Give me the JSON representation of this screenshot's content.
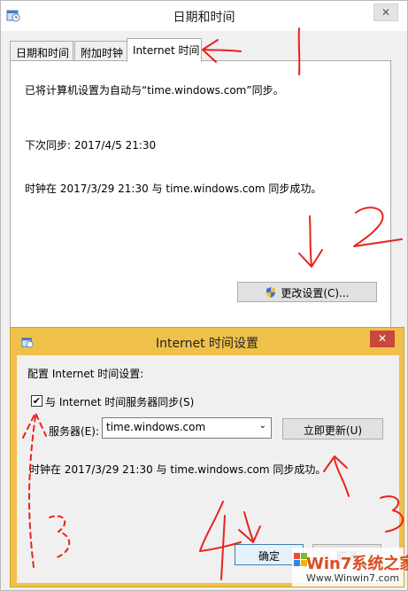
{
  "main_dialog": {
    "title": "日期和时间",
    "close_glyph": "✕",
    "tabs": [
      {
        "label": "日期和时间"
      },
      {
        "label": "附加时钟"
      },
      {
        "label": "Internet 时间"
      }
    ],
    "sync_info": "已将计算机设置为自动与“time.windows.com”同步。",
    "next_sync": "下次同步: 2017/4/5 21:30",
    "last_sync": "时钟在 2017/3/29 21:30 与 time.windows.com 同步成功。",
    "change_settings_label": "更改设置(C)..."
  },
  "sub_dialog": {
    "title": "Internet 时间设置",
    "close_glyph": "✕",
    "config_label": "配置 Internet 时间设置:",
    "sync_checkbox_label": "与 Internet 时间服务器同步(S)",
    "sync_checked": true,
    "server_label": "服务器(E):",
    "server_value": "time.windows.com",
    "update_now_label": "立即更新(U)",
    "status": "时钟在 2017/3/29 21:30 与 time.windows.com 同步成功。",
    "ok_label": "确定",
    "cancel_label": "取消"
  },
  "annotations": {
    "numbers": [
      "1",
      "2",
      "3",
      "3",
      "4"
    ]
  },
  "watermark": {
    "brand": "Win7系统之家",
    "url": "Www.Winwin7.com"
  },
  "colors": {
    "sub_dialog_frame": "#f0c14a",
    "annotation_red": "#e8231c",
    "close_red": "#c9483d"
  },
  "icons": [
    "calendar-clock-icon",
    "shield-icon",
    "windows-logo-icon"
  ]
}
